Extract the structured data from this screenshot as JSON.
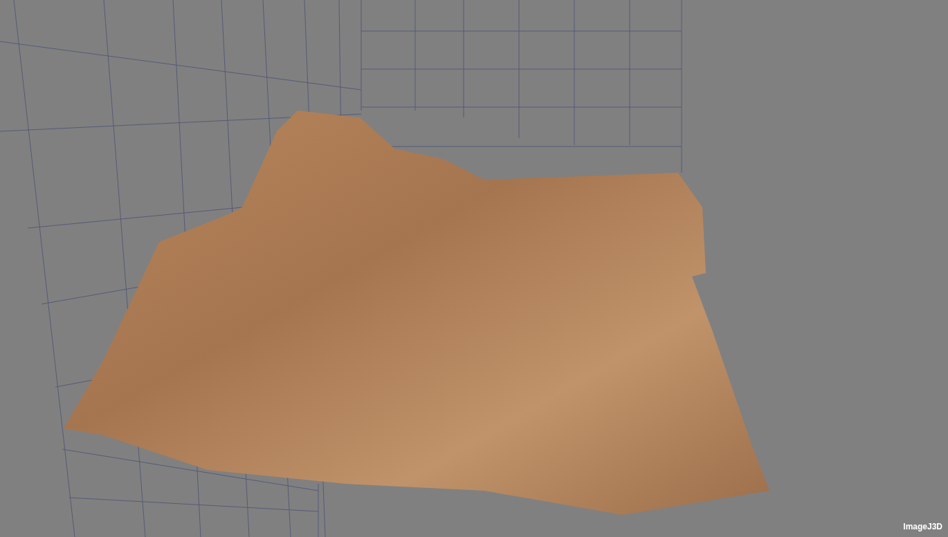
{
  "viewer": {
    "label": "ImageJ3D"
  }
}
